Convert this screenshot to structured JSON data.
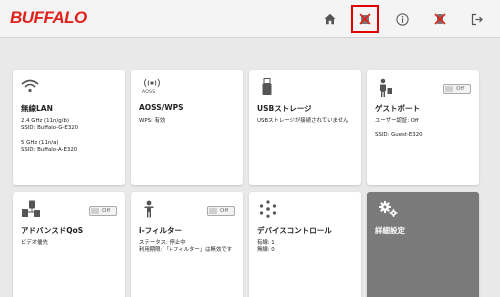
{
  "brand": {
    "logo_text": "BUFFALO",
    "color": "#e0201b"
  },
  "nav": {
    "icons": [
      "home-icon",
      "wireless-off-icon",
      "info-icon",
      "alert-icon",
      "logout-icon"
    ],
    "active": "wireless-off-icon"
  },
  "cards": {
    "wlan": {
      "title": "無線LAN",
      "l1": "2.4 GHz (11n/g/b)",
      "l2": "SSID: Buffalo-G-E320",
      "l3": "5 GHz (11n/a)",
      "l4": "SSID: Buffalo-A-E320"
    },
    "aoss": {
      "icon_label": "AOSS",
      "title": "AOSS/WPS",
      "l1": "WPS: 有効"
    },
    "usb": {
      "title": "USBストレージ",
      "l1": "USBストレージが接続されていません"
    },
    "guest": {
      "title": "ゲストポート",
      "toggle": "Off",
      "l1": "ユーザー認証: Off",
      "l2": "SSID: Guest-E320"
    },
    "qos": {
      "title": "アドバンスドQoS",
      "toggle": "Off",
      "l1": "ビデオ優先"
    },
    "ifilter": {
      "title": "i-フィルター",
      "toggle": "Off",
      "l1": "ステータス: 停止中",
      "l2": "利用期限: 「i-フィルター」は無効です"
    },
    "device": {
      "title": "デバイスコントロール",
      "l1": "有線: 1",
      "l2": "無線: 0"
    },
    "advanced": {
      "title": "詳細設定"
    }
  }
}
